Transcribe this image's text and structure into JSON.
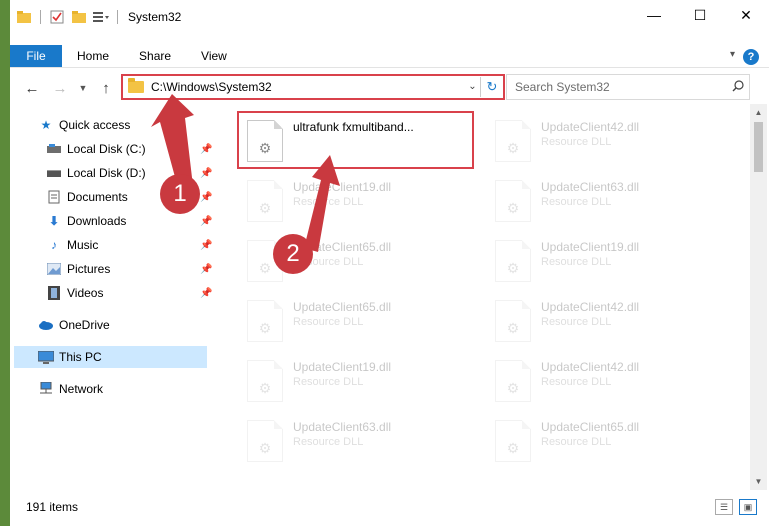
{
  "window": {
    "title": "System32",
    "controls": {
      "minimize": "—",
      "maximize": "☐",
      "close": "✕"
    }
  },
  "ribbon": {
    "tabs": [
      "File",
      "Home",
      "Share",
      "View"
    ],
    "help": "?"
  },
  "nav": {
    "address": "C:\\Windows\\System32",
    "search_placeholder": "Search System32"
  },
  "sidebar": {
    "items": [
      {
        "label": "Quick access",
        "icon": "star-icon"
      },
      {
        "label": "Local Disk (C:)",
        "icon": "drive-icon",
        "pinned": true
      },
      {
        "label": "Local Disk (D:)",
        "icon": "drive-icon",
        "pinned": true
      },
      {
        "label": "Documents",
        "icon": "documents-icon",
        "pinned": true
      },
      {
        "label": "Downloads",
        "icon": "downloads-icon",
        "pinned": true
      },
      {
        "label": "Music",
        "icon": "music-icon",
        "pinned": true
      },
      {
        "label": "Pictures",
        "icon": "pictures-icon",
        "pinned": true
      },
      {
        "label": "Videos",
        "icon": "videos-icon",
        "pinned": true
      },
      {
        "label": "OneDrive",
        "icon": "cloud-icon"
      },
      {
        "label": "This PC",
        "icon": "computer-icon",
        "selected": true
      },
      {
        "label": "Network",
        "icon": "network-icon"
      }
    ]
  },
  "files": [
    {
      "name": "ultrafunk fxmultiband...",
      "type": "",
      "highlighted": true
    },
    {
      "name": "UpdateClient42.dll",
      "type": "Resource DLL"
    },
    {
      "name": "UpdateClient19.dll",
      "type": "Resource DLL"
    },
    {
      "name": "UpdateClient63.dll",
      "type": "Resource DLL"
    },
    {
      "name": "UpdateClient65.dll",
      "type": "Resource DLL"
    },
    {
      "name": "UpdateClient19.dll",
      "type": "Resource DLL"
    },
    {
      "name": "UpdateClient65.dll",
      "type": "Resource DLL"
    },
    {
      "name": "UpdateClient42.dll",
      "type": "Resource DLL"
    },
    {
      "name": "UpdateClient19.dll",
      "type": "Resource DLL"
    },
    {
      "name": "UpdateClient42.dll",
      "type": "Resource DLL"
    },
    {
      "name": "UpdateClient63.dll",
      "type": "Resource DLL"
    },
    {
      "name": "UpdateClient65.dll",
      "type": "Resource DLL"
    }
  ],
  "status": {
    "item_count": "191 items"
  },
  "callouts": {
    "step1": "1",
    "step2": "2"
  },
  "colors": {
    "accent": "#1979ca",
    "highlight": "#d9414b",
    "callout": "#c9393f",
    "selected": "#cce8ff"
  }
}
